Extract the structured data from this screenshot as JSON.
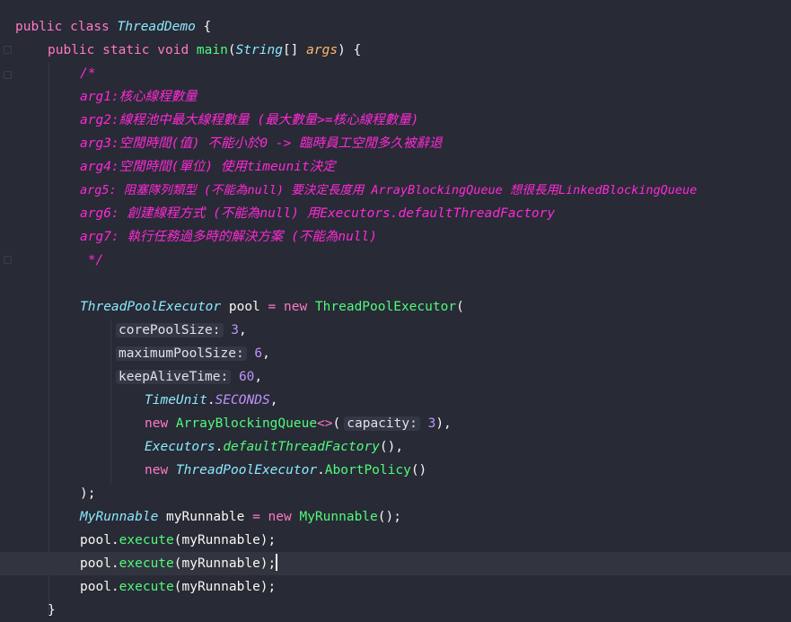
{
  "code": {
    "l1": {
      "kw1": "public",
      "kw2": "class",
      "name": "ThreadDemo",
      "brace": " {"
    },
    "l2": {
      "kw1": "public",
      "kw2": "static",
      "kw3": "void",
      "fn": "main",
      "p1": "(",
      "type": "String",
      "arr": "[] ",
      "arg": "args",
      "p2": ") {"
    },
    "l3": {
      "text": "/*"
    },
    "l4": {
      "text": "arg1:核心線程數量"
    },
    "l5": {
      "text": "arg2:線程池中最大線程數量 (最大數量>=核心線程數量)"
    },
    "l6": {
      "text": "arg3:空閒時間(值) 不能小於0 -> 臨時員工空閒多久被辭退"
    },
    "l7": {
      "text": "arg4:空閒時間(單位) 使用timeunit決定"
    },
    "l8": {
      "text": "arg5: 阻塞隊列類型 (不能為null) 要決定長度用 ArrayBlockingQueue 想很長用LinkedBlockingQueue"
    },
    "l9": {
      "text": "arg6: 創建線程方式 (不能為null) 用Executors.defaultThreadFactory"
    },
    "l10": {
      "text": "arg7: 執行任務過多時的解決方案 (不能為null)"
    },
    "l11": {
      "text": " */"
    },
    "l13": {
      "type": "ThreadPoolExecutor",
      "var": " pool ",
      "eq": "= ",
      "kw": "new ",
      "ctor": "ThreadPoolExecutor",
      "open": "("
    },
    "l14": {
      "hint": "corePoolSize:",
      "val": "3",
      "end": ","
    },
    "l15": {
      "hint": "maximumPoolSize:",
      "val": "6",
      "end": ","
    },
    "l16": {
      "hint": "keepAliveTime:",
      "val": "60",
      "end": ","
    },
    "l17": {
      "cls": "TimeUnit",
      "dot": ".",
      "cst": "SECONDS",
      "end": ","
    },
    "l18": {
      "kw": "new ",
      "cls": "ArrayBlockingQueue",
      "gen": "<>",
      "open": "(",
      "hint": "capacity:",
      "val": "3",
      "end": "),"
    },
    "l19": {
      "cls": "Executors",
      "dot": ".",
      "fn": "defaultThreadFactory",
      "end": "(),"
    },
    "l20": {
      "kw": "new ",
      "cls": "ThreadPoolExecutor",
      "dot": ".",
      "inner": "AbortPolicy",
      "end": "()"
    },
    "l21": {
      "text": ");"
    },
    "l22": {
      "type": "MyRunnable",
      "var": " myRunnable ",
      "eq": "= ",
      "kw": "new ",
      "ctor": "MyRunnable",
      "end": "();"
    },
    "l23": {
      "obj": "pool",
      "dot": ".",
      "fn": "execute",
      "args": "(myRunnable);"
    },
    "l24": {
      "obj": "pool",
      "dot": ".",
      "fn": "execute",
      "args": "(myRunnable);"
    },
    "l25": {
      "obj": "pool",
      "dot": ".",
      "fn": "execute",
      "args": "(myRunnable);"
    },
    "l26": {
      "text": "}"
    }
  },
  "colors": {
    "background": "#282a36",
    "keyword": "#ff79c6",
    "comment": "#ff29d6",
    "class": "#8be9fd",
    "function": "#50fa7b",
    "number": "#bd93f9",
    "param": "#ffb86c"
  }
}
